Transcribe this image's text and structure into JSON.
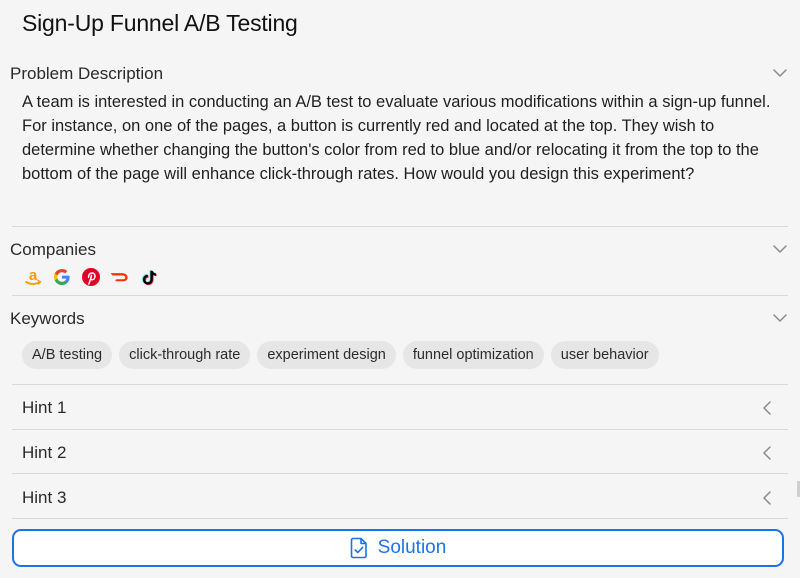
{
  "page": {
    "title": "Sign-Up Funnel A/B Testing"
  },
  "problem": {
    "header": "Problem Description",
    "text": "A team is interested in conducting an A/B test to evaluate various modifications within a sign-up funnel. For instance, on one of the pages, a button is currently red and located at the top. They wish to determine whether changing the button's color from red to blue and/or relocating it from the top to the bottom of the page will enhance click-through rates. How would you design this experiment?"
  },
  "companies": {
    "header": "Companies",
    "icons": [
      "amazon-icon",
      "google-icon",
      "pinterest-icon",
      "doordash-icon",
      "tiktok-icon"
    ]
  },
  "keywords": {
    "header": "Keywords",
    "items": [
      "A/B testing",
      "click-through rate",
      "experiment design",
      "funnel optimization",
      "user behavior"
    ]
  },
  "hints": [
    {
      "label": "Hint 1"
    },
    {
      "label": "Hint 2"
    },
    {
      "label": "Hint 3"
    }
  ],
  "solution": {
    "label": "Solution"
  },
  "colors": {
    "accent": "#1a73e8",
    "chip_bg": "#e6e6e6",
    "background": "#f5f5f5",
    "amazon": "#ff9900",
    "pinterest": "#e60023",
    "doordash": "#ff3008"
  }
}
